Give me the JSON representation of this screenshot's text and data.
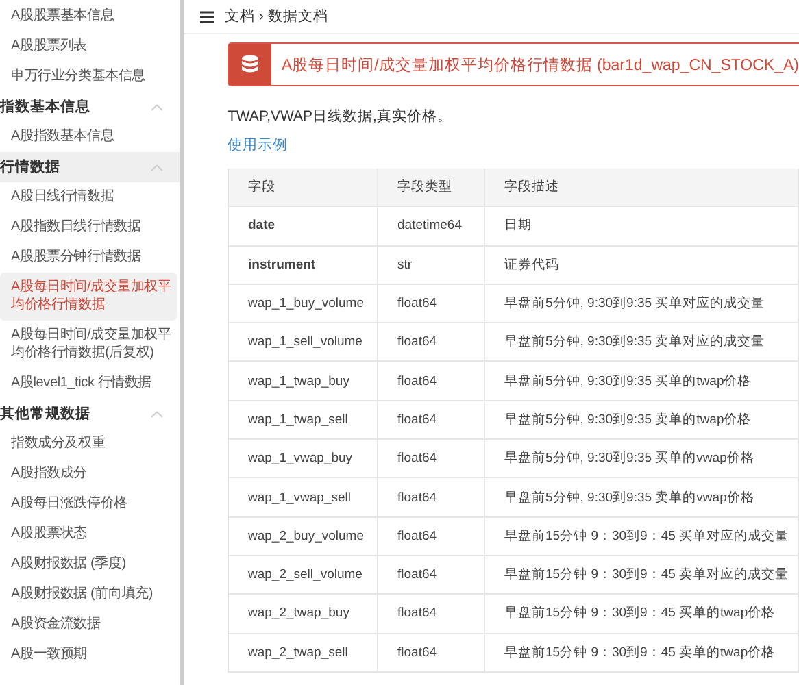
{
  "sidebar": {
    "entries": [
      {
        "kind": "item",
        "label": "A股股票基本信息",
        "selected": false
      },
      {
        "kind": "item",
        "label": "A股股票列表",
        "selected": false
      },
      {
        "kind": "item",
        "label": "申万行业分类基本信息",
        "selected": false
      },
      {
        "kind": "section",
        "label": "指数基本信息",
        "expanded": true,
        "selected": false,
        "children": [
          {
            "label": "A股指数基本信息",
            "selected": false
          }
        ]
      },
      {
        "kind": "section",
        "label": "行情数据",
        "expanded": true,
        "selected": true,
        "children": [
          {
            "label": "A股日线行情数据",
            "selected": false
          },
          {
            "label": "A股指数日线行情数据",
            "selected": false
          },
          {
            "label": "A股股票分钟行情数据",
            "selected": false
          },
          {
            "label": "A股每日时间/成交量加权平均价格行情数据",
            "selected": true
          },
          {
            "label": "A股每日时间/成交量加权平均价格行情数据(后复权)",
            "selected": false
          },
          {
            "label": "A股level1_tick 行情数据",
            "selected": false
          }
        ]
      },
      {
        "kind": "section",
        "label": "其他常规数据",
        "expanded": true,
        "selected": false,
        "children": [
          {
            "label": "指数成分及权重",
            "selected": false
          },
          {
            "label": "A股指数成分",
            "selected": false
          },
          {
            "label": "A股每日涨跌停价格",
            "selected": false
          },
          {
            "label": "A股股票状态",
            "selected": false
          },
          {
            "label": "A股财报数据 (季度)",
            "selected": false
          },
          {
            "label": "A股财报数据 (前向填充)",
            "selected": false
          },
          {
            "label": "A股资金流数据",
            "selected": false
          },
          {
            "label": "A股一致预期",
            "selected": false
          }
        ]
      }
    ]
  },
  "breadcrumb": {
    "items": [
      "文档",
      "数据文档"
    ],
    "separator": "›"
  },
  "title": "A股每日时间/成交量加权平均价格行情数据 (bar1d_wap_CN_STOCK_A)",
  "description": "TWAP,VWAP日线数据,真实价格。",
  "example_link": "使用示例",
  "table": {
    "columns": [
      "字段",
      "字段类型",
      "字段描述"
    ],
    "rows": [
      {
        "field": "date",
        "bold": true,
        "type": "datetime64",
        "desc": "日期"
      },
      {
        "field": "instrument",
        "bold": true,
        "type": "str",
        "desc": "证券代码"
      },
      {
        "field": "wap_1_buy_volume",
        "bold": false,
        "type": "float64",
        "desc": "早盘前5分钟, 9:30到9:35 买单对应的成交量"
      },
      {
        "field": "wap_1_sell_volume",
        "bold": false,
        "type": "float64",
        "desc": "早盘前5分钟, 9:30到9:35 卖单对应的成交量"
      },
      {
        "field": "wap_1_twap_buy",
        "bold": false,
        "type": "float64",
        "desc": "早盘前5分钟, 9:30到9:35 买单的twap价格"
      },
      {
        "field": "wap_1_twap_sell",
        "bold": false,
        "type": "float64",
        "desc": "早盘前5分钟, 9:30到9:35 卖单的twap价格"
      },
      {
        "field": "wap_1_vwap_buy",
        "bold": false,
        "type": "float64",
        "desc": "早盘前5分钟, 9:30到9:35 买单的vwap价格"
      },
      {
        "field": "wap_1_vwap_sell",
        "bold": false,
        "type": "float64",
        "desc": "早盘前5分钟, 9:30到9:35 卖单的vwap价格"
      },
      {
        "field": "wap_2_buy_volume",
        "bold": false,
        "type": "float64",
        "desc": "早盘前15分钟 9：30到9：45 买单对应的成交量"
      },
      {
        "field": "wap_2_sell_volume",
        "bold": false,
        "type": "float64",
        "desc": "早盘前15分钟 9：30到9：45 卖单对应的成交量"
      },
      {
        "field": "wap_2_twap_buy",
        "bold": false,
        "type": "float64",
        "desc": "早盘前15分钟 9：30到9：45 买单的twap价格"
      },
      {
        "field": "wap_2_twap_sell",
        "bold": false,
        "type": "float64",
        "desc": "早盘前15分钟 9：30到9：45 卖单的twap价格"
      }
    ]
  }
}
